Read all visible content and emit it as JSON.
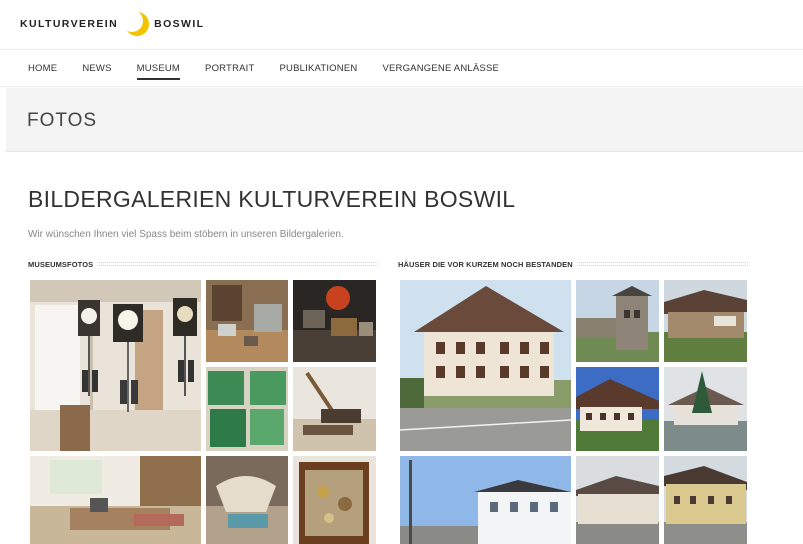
{
  "logo": {
    "left_word": "KULTURVEREIN",
    "right_word": "BOSWIL"
  },
  "nav": {
    "items": [
      {
        "label": "HOME"
      },
      {
        "label": "NEWS"
      },
      {
        "label": "MUSEUM",
        "active": true
      },
      {
        "label": "PORTRAIT"
      },
      {
        "label": "PUBLIKATIONEN"
      },
      {
        "label": "VERGANGENE ANLÄSSE"
      }
    ]
  },
  "band": {
    "title": "FOTOS"
  },
  "main": {
    "title": "BILDERGALERIEN KULTURVEREIN BOSWIL",
    "intro": "Wir wünschen Ihnen viel Spass beim stöbern in unseren Bildergalerien."
  },
  "galleries": [
    {
      "heading": "MUSEUMSFOTOS"
    },
    {
      "heading": "HÄUSER DIE VOR KURZEM NOCH BESTANDEN"
    }
  ],
  "colors": {
    "accent_moon": "#f4c300",
    "nav_text": "#333333",
    "band_bg": "#f4f4f4"
  }
}
